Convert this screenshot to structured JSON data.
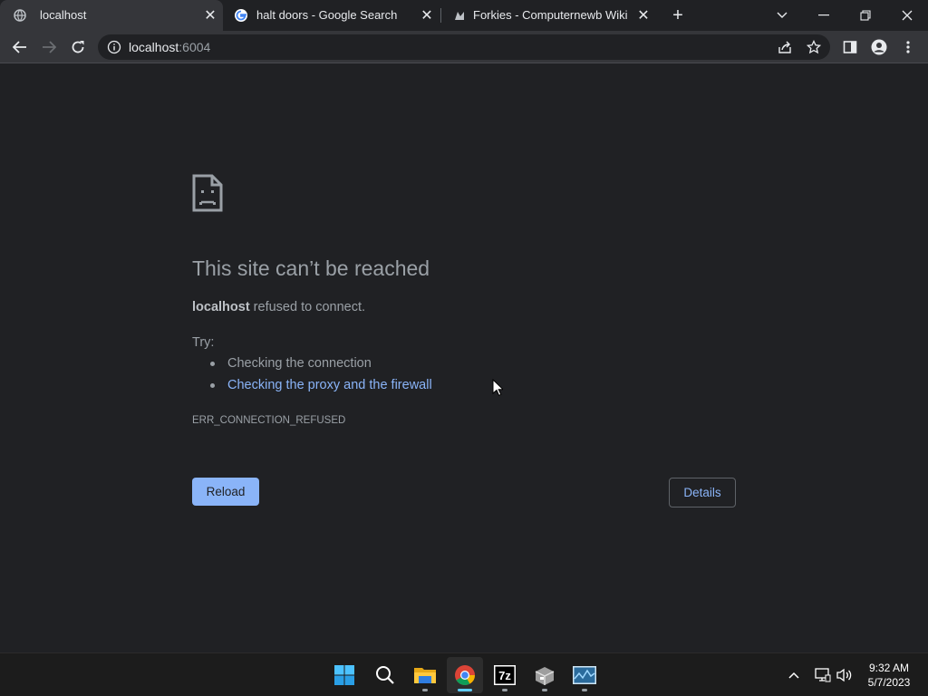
{
  "tabs": [
    {
      "title": "localhost",
      "active": true,
      "favicon": "globe-icon"
    },
    {
      "title": "halt doors - Google Search",
      "active": false,
      "favicon": "google-icon"
    },
    {
      "title": "Forkies - Computernewb Wiki",
      "active": false,
      "favicon": "wiki-icon"
    }
  ],
  "address_bar": {
    "host": "localhost",
    "port": ":6004"
  },
  "error_page": {
    "title": "This site can’t be reached",
    "host": "localhost",
    "message": " refused to connect.",
    "try_label": "Try:",
    "suggestions": [
      "Checking the connection",
      "Checking the proxy and the firewall"
    ],
    "error_code": "ERR_CONNECTION_REFUSED",
    "reload_label": "Reload",
    "details_label": "Details"
  },
  "taskbar": {
    "apps": [
      "windows-start-icon",
      "search-icon",
      "file-explorer-icon",
      "chrome-icon",
      "7zip-icon",
      "package-icon",
      "resource-monitor-icon"
    ],
    "time": "9:32 AM",
    "date": "5/7/2023"
  },
  "colors": {
    "accent": "#8ab4f8",
    "background": "#202124",
    "toolbar": "#35363a"
  }
}
